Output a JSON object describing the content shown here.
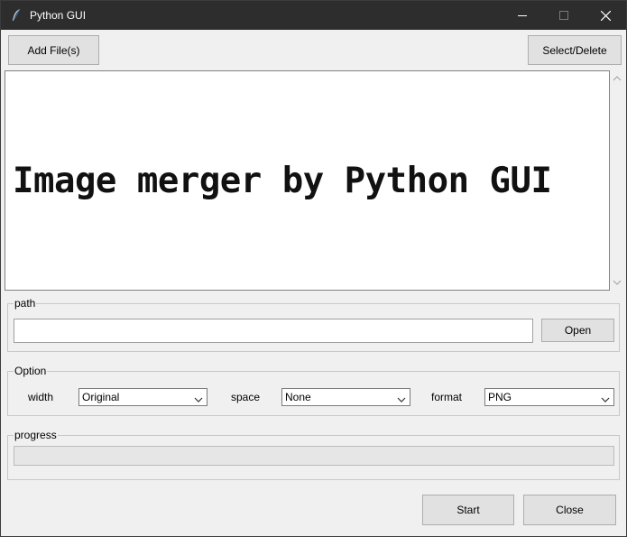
{
  "window": {
    "title": "Python GUI",
    "icon": "feather-icon"
  },
  "toolbar": {
    "add_files": "Add File(s)",
    "select_delete": "Select/Delete"
  },
  "canvas": {
    "text": "Image merger by Python GUI"
  },
  "path": {
    "legend": "path",
    "value": "",
    "open": "Open"
  },
  "option": {
    "legend": "Option",
    "width_label": "width",
    "width_value": "Original",
    "space_label": "space",
    "space_value": "None",
    "format_label": "format",
    "format_value": "PNG"
  },
  "progress": {
    "legend": "progress",
    "value": 0
  },
  "footer": {
    "start": "Start",
    "close": "Close"
  }
}
